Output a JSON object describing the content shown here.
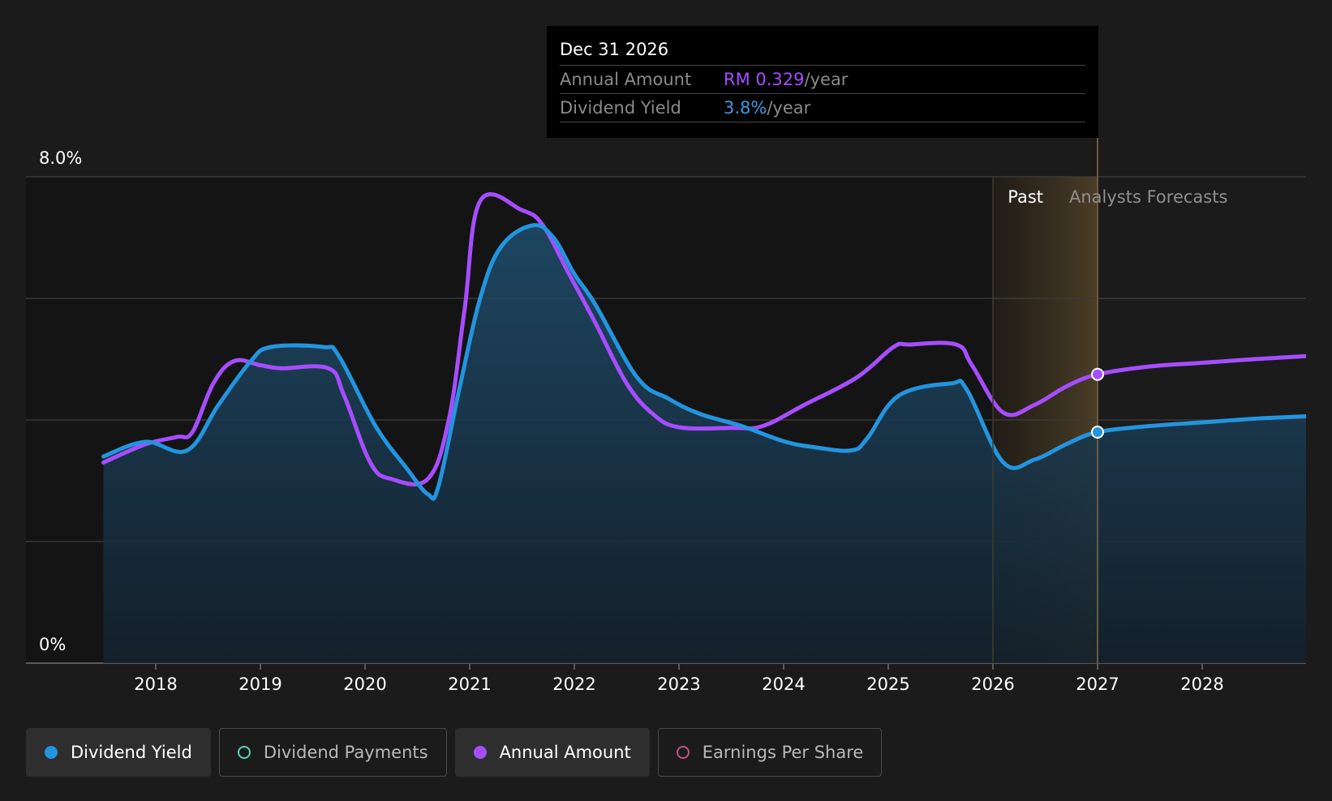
{
  "tooltip": {
    "date": "Dec 31 2026",
    "annual_label": "Annual Amount",
    "annual_value": "RM 0.329",
    "annual_unit": "/year",
    "yield_label": "Dividend Yield",
    "yield_value": "3.8%",
    "yield_unit": "/year"
  },
  "regions": {
    "past": "Past",
    "forecast": "Analysts Forecasts"
  },
  "legend": [
    {
      "label": "Dividend Yield",
      "color": "#2394df",
      "filled": true,
      "active": true
    },
    {
      "label": "Dividend Payments",
      "color": "#5ad0c0",
      "filled": false,
      "active": false
    },
    {
      "label": "Annual Amount",
      "color": "#a64dff",
      "filled": true,
      "active": true
    },
    {
      "label": "Earnings Per Share",
      "color": "#c0508a",
      "filled": false,
      "active": false
    }
  ],
  "colors": {
    "yield": "#2394df",
    "annual": "#a64dff",
    "background": "#1b1b1b"
  },
  "chart_data": {
    "type": "line",
    "ylim": [
      0,
      8
    ],
    "y_ticks": [
      "0%",
      "8.0%"
    ],
    "x_ticks": [
      "2018",
      "2019",
      "2020",
      "2021",
      "2022",
      "2023",
      "2024",
      "2025",
      "2026",
      "2027",
      "2028"
    ],
    "xlim": [
      2017.0,
      2029.0
    ],
    "past_until": 2027.0,
    "grid": true,
    "series": [
      {
        "name": "Dividend Yield",
        "unit": "%",
        "points": [
          [
            2017.5,
            3.4
          ],
          [
            2017.9,
            3.64
          ],
          [
            2018.3,
            3.5
          ],
          [
            2018.6,
            4.25
          ],
          [
            2018.9,
            4.95
          ],
          [
            2019.1,
            5.2
          ],
          [
            2019.6,
            5.2
          ],
          [
            2019.75,
            5.05
          ],
          [
            2020.1,
            3.9
          ],
          [
            2020.4,
            3.2
          ],
          [
            2020.6,
            2.78
          ],
          [
            2020.7,
            2.9
          ],
          [
            2020.9,
            4.5
          ],
          [
            2021.1,
            6.0
          ],
          [
            2021.3,
            6.85
          ],
          [
            2021.6,
            7.2
          ],
          [
            2021.8,
            7.0
          ],
          [
            2022.0,
            6.4
          ],
          [
            2022.2,
            5.9
          ],
          [
            2022.6,
            4.7
          ],
          [
            2022.9,
            4.35
          ],
          [
            2023.2,
            4.1
          ],
          [
            2023.6,
            3.9
          ],
          [
            2024.0,
            3.65
          ],
          [
            2024.3,
            3.55
          ],
          [
            2024.65,
            3.5
          ],
          [
            2024.8,
            3.7
          ],
          [
            2025.1,
            4.4
          ],
          [
            2025.6,
            4.6
          ],
          [
            2025.75,
            4.5
          ],
          [
            2026.1,
            3.3
          ],
          [
            2026.4,
            3.35
          ],
          [
            2026.7,
            3.6
          ],
          [
            2027.0,
            3.8
          ],
          [
            2027.5,
            3.9
          ],
          [
            2028.0,
            3.96
          ],
          [
            2028.5,
            4.02
          ],
          [
            2029.0,
            4.06
          ]
        ]
      },
      {
        "name": "Annual Amount",
        "unit": "RM",
        "points": [
          [
            2017.5,
            3.3
          ],
          [
            2017.9,
            3.6
          ],
          [
            2018.2,
            3.72
          ],
          [
            2018.35,
            3.8
          ],
          [
            2018.55,
            4.6
          ],
          [
            2018.75,
            4.97
          ],
          [
            2019.0,
            4.9
          ],
          [
            2019.2,
            4.85
          ],
          [
            2019.65,
            4.85
          ],
          [
            2019.8,
            4.4
          ],
          [
            2020.05,
            3.3
          ],
          [
            2020.25,
            3.03
          ],
          [
            2020.6,
            3.03
          ],
          [
            2020.8,
            4.0
          ],
          [
            2020.95,
            5.8
          ],
          [
            2021.1,
            7.6
          ],
          [
            2021.5,
            7.45
          ],
          [
            2021.7,
            7.2
          ],
          [
            2021.95,
            6.4
          ],
          [
            2022.2,
            5.6
          ],
          [
            2022.5,
            4.6
          ],
          [
            2022.75,
            4.1
          ],
          [
            2023.0,
            3.88
          ],
          [
            2023.5,
            3.87
          ],
          [
            2023.8,
            3.9
          ],
          [
            2024.2,
            4.25
          ],
          [
            2024.7,
            4.7
          ],
          [
            2025.05,
            5.2
          ],
          [
            2025.2,
            5.24
          ],
          [
            2025.65,
            5.24
          ],
          [
            2025.8,
            4.9
          ],
          [
            2026.1,
            4.12
          ],
          [
            2026.4,
            4.25
          ],
          [
            2026.7,
            4.55
          ],
          [
            2027.0,
            4.75
          ],
          [
            2027.5,
            4.88
          ],
          [
            2028.0,
            4.94
          ],
          [
            2028.5,
            5.0
          ],
          [
            2029.0,
            5.05
          ]
        ]
      }
    ]
  }
}
